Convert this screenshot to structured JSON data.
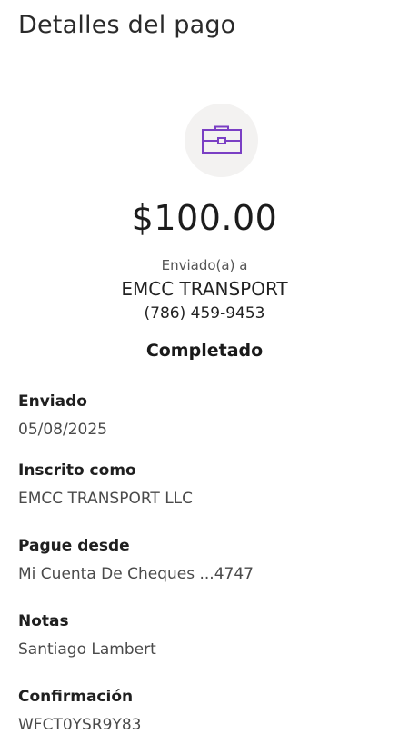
{
  "header": {
    "title": "Detalles del pago"
  },
  "icon": {
    "name": "briefcase-icon",
    "color": "#7a3fc4",
    "background": "#f3f2f1"
  },
  "payment": {
    "amount": "$100.00",
    "sent_to_label": "Enviado(a) a",
    "recipient_name": "EMCC TRANSPORT",
    "recipient_phone": "(786) 459-9453",
    "status": "Completado"
  },
  "details": [
    {
      "label": "Enviado",
      "value": "05/08/2025"
    },
    {
      "label": "Inscrito como",
      "value": "EMCC TRANSPORT LLC"
    },
    {
      "label": "Pague desde",
      "value": "Mi Cuenta De Cheques ...4747"
    },
    {
      "label": "Notas",
      "value": "Santiago Lambert"
    },
    {
      "label": "Confirmación",
      "value": "WFCT0YSR9Y83"
    }
  ]
}
